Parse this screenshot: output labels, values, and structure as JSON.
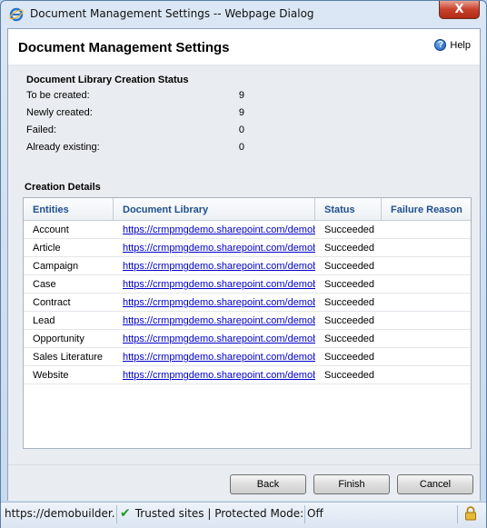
{
  "window": {
    "title": "Document Management Settings -- Webpage Dialog",
    "close_glyph": "X"
  },
  "header": {
    "title": "Document Management Settings",
    "help_label": "Help",
    "help_icon": "help-icon"
  },
  "status_section": {
    "title": "Document Library Creation Status",
    "rows": [
      {
        "label": "To be created:",
        "value": "9"
      },
      {
        "label": "Newly created:",
        "value": "9"
      },
      {
        "label": "Failed:",
        "value": "0"
      },
      {
        "label": "Already existing:",
        "value": "0"
      }
    ]
  },
  "details_section": {
    "title": "Creation Details",
    "columns": [
      "Entities",
      "Document Library",
      "Status",
      "Failure Reason"
    ],
    "rows": [
      {
        "entity": "Account",
        "library": "https://crmpmgdemo.sharepoint.com/demobuilder/account",
        "status": "Succeeded",
        "reason": ""
      },
      {
        "entity": "Article",
        "library": "https://crmpmgdemo.sharepoint.com/demobuilder/kbarticle",
        "status": "Succeeded",
        "reason": ""
      },
      {
        "entity": "Campaign",
        "library": "https://crmpmgdemo.sharepoint.com/demobuilder/campaign",
        "status": "Succeeded",
        "reason": ""
      },
      {
        "entity": "Case",
        "library": "https://crmpmgdemo.sharepoint.com/demobuilder/incident",
        "status": "Succeeded",
        "reason": ""
      },
      {
        "entity": "Contract",
        "library": "https://crmpmgdemo.sharepoint.com/demobuilder/contract",
        "status": "Succeeded",
        "reason": ""
      },
      {
        "entity": "Lead",
        "library": "https://crmpmgdemo.sharepoint.com/demobuilder/lead",
        "status": "Succeeded",
        "reason": ""
      },
      {
        "entity": "Opportunity",
        "library": "https://crmpmgdemo.sharepoint.com/demobuilder/opportunity",
        "status": "Succeeded",
        "reason": ""
      },
      {
        "entity": "Sales Literature",
        "library": "https://crmpmgdemo.sharepoint.com/demobuilder/salesliterature",
        "status": "Succeeded",
        "reason": ""
      },
      {
        "entity": "Website",
        "library": "https://crmpmgdemo.sharepoint.com/demobuilder/website",
        "status": "Succeeded",
        "reason": ""
      }
    ]
  },
  "footer": {
    "back_label": "Back",
    "finish_label": "Finish",
    "cancel_label": "Cancel"
  },
  "statusbar": {
    "url": "https://demobuilder.crm.dynamics.com/",
    "zone": "Trusted sites | Protected Mode: Off",
    "zone_icon": "check-icon",
    "lock_icon": "lock-icon"
  },
  "colors": {
    "link": "#0000cc",
    "column_header": "#1e4f8d",
    "close_button": "#c7402b"
  }
}
